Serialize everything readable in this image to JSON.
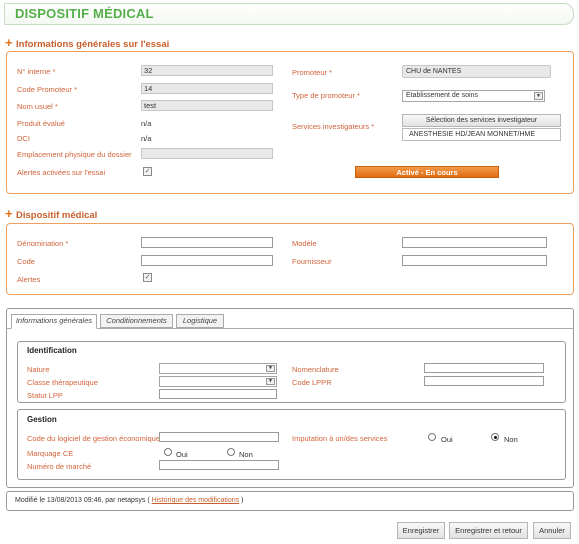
{
  "page": {
    "title": "DISPOSITIF MÉDICAL"
  },
  "infos_generales": {
    "section_title": "Informations générales sur l'essai",
    "left": {
      "numero_interne_label": "N° interne *",
      "numero_interne_value": "32",
      "code_promoteur_label": "Code Promoteur *",
      "code_promoteur_value": "14",
      "nom_usuel_label": "Nom usuel *",
      "nom_usuel_value": "test",
      "produit_evalue_label": "Produit évalué",
      "produit_evalue_value": "n/a",
      "dci_label": "DCI",
      "dci_value": "n/a",
      "emplacement_label": "Emplacement physique du dossier",
      "emplacement_value": "",
      "alertes_label": "Alertes activées sur l'essai",
      "alertes_checked": true
    },
    "right": {
      "promoteur_label": "Promoteur *",
      "promoteur_value": "CHU de NANTES",
      "type_promoteur_label": "Type de promoteur *",
      "type_promoteur_value": "Etablissement de soins",
      "services_label": "Services investigateurs *",
      "services_button": "Sélection des services investigateur",
      "services_value": "ANESTHESIE HD/JEAN MONNET/HME",
      "status_button": "Activé - En cours"
    }
  },
  "dispositif": {
    "section_title": "Dispositif médical",
    "denomination_label": "Dénomination *",
    "denomination_value": "",
    "code_label": "Code",
    "code_value": "",
    "alertes_label": "Alertes",
    "alertes_checked": true,
    "modele_label": "Modèle",
    "modele_value": "",
    "fournisseur_label": "Fournisseur",
    "fournisseur_value": ""
  },
  "tabs": [
    "Informations générales",
    "Conditionnements",
    "Logistique"
  ],
  "identification": {
    "title": "Identification",
    "nature_label": "Nature",
    "nature_value": "",
    "classe_label": "Classe thérapeutique",
    "classe_value": "",
    "statut_label": "Statut LPP",
    "statut_value": "",
    "nomenclature_label": "Nomenclature",
    "nomenclature_value": "",
    "lppr_label": "Code LPPR",
    "lppr_value": ""
  },
  "gestion": {
    "title": "Gestion",
    "code_logiciel_label": "Code du logiciel de gestion économique",
    "code_logiciel_value": "",
    "marquage_label": "Marquage CE",
    "marquage_oui": "Oui",
    "marquage_non": "Non",
    "marquage_selected": "none",
    "numero_marche_label": "Numéro de marché",
    "numero_marche_value": "",
    "imputation_label": "Imputation à un/des services",
    "imputation_oui": "Oui",
    "imputation_non": "Non",
    "imputation_selected": "Non"
  },
  "footer": {
    "modified_text": "Modifié le 13/08/2013 09:46, par netapsys (",
    "history_link": "Historique des modifications",
    "close_paren": ")"
  },
  "actions": {
    "save": "Enregistrer",
    "save_return": "Enregistrer et retour",
    "cancel": "Annuler"
  },
  "colors": {
    "title_green": "#55ae4a",
    "section_orange": "#c8602d",
    "label_orange": "#d0633a",
    "status_button": "#e06d12"
  }
}
